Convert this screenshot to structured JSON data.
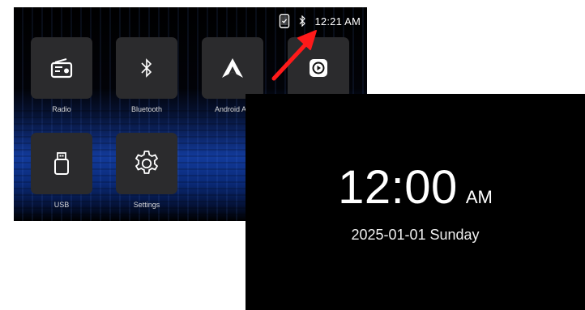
{
  "status_bar": {
    "time": "12:21 AM",
    "icons": [
      "phone-icon",
      "bluetooth-icon"
    ]
  },
  "apps": [
    {
      "label": "Radio",
      "icon": "radio-icon"
    },
    {
      "label": "Bluetooth",
      "icon": "bluetooth-icon"
    },
    {
      "label": "Android Au",
      "icon": "android-auto-icon"
    },
    {
      "label": "",
      "icon": "carplay-icon"
    },
    {
      "label": "USB",
      "icon": "usb-icon"
    },
    {
      "label": "Settings",
      "icon": "gear-icon"
    }
  ],
  "clock": {
    "time": "12:00",
    "ampm": "AM",
    "date": "2025-01-01 Sunday"
  },
  "colors": {
    "annotation_arrow": "#ff1a1a",
    "tile_background": "#2b2b2d",
    "clock_background": "#000000"
  }
}
